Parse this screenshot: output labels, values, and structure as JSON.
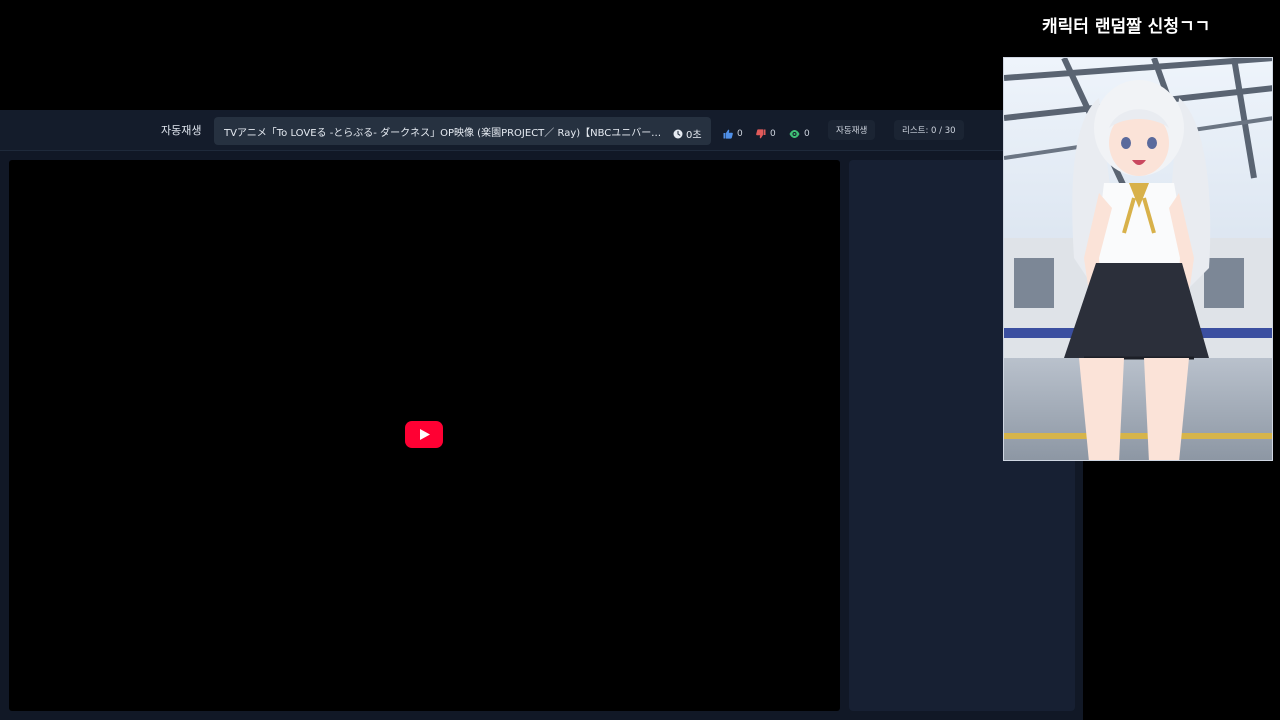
{
  "overlay": {
    "title": "캐릭터 랜덤짤 신청ㄱㄱ",
    "image_label": "character-illustration"
  },
  "toolbar": {
    "autoplay_label": "자동재생",
    "video_title": "TVアニメ「To LOVEる -とらぶる- ダークネス」OP映像 (楽園PROJECT／ Ray)【NBCユニバーサルAnime・Music】",
    "timer": "0초",
    "likes": "0",
    "dislikes": "0",
    "views": "0",
    "autoplay_button": "자동재생",
    "list_count": "리스트: 0 / 30"
  },
  "colors": {
    "panel_bg": "#111826",
    "toolbar_bg": "#141c2b",
    "title_box": "#263140",
    "youtube_red": "#ff0033",
    "like_blue": "#4f8fe8",
    "dislike_red": "#e05a5a",
    "view_green": "#3fbf75"
  },
  "icons": {
    "timer": "clock-icon",
    "likes": "thumbs-up-icon",
    "dislikes": "thumbs-down-icon",
    "views": "eye-icon",
    "play": "youtube-play-icon"
  }
}
